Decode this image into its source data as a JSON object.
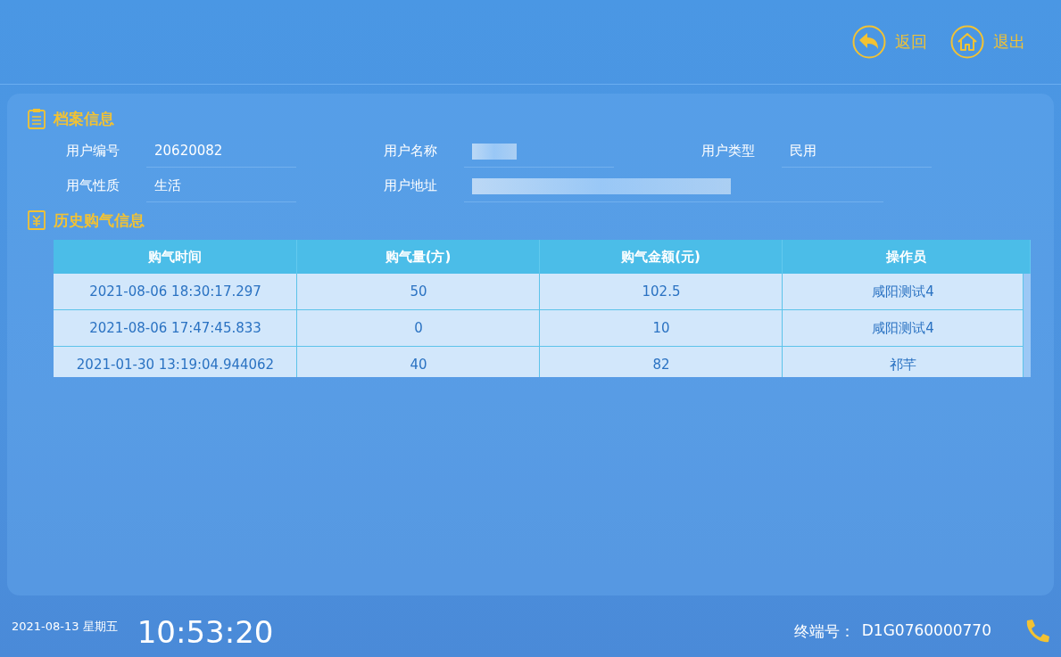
{
  "header": {
    "buttons": [
      {
        "kind": "back",
        "label": "返回"
      },
      {
        "kind": "home",
        "label": "退出"
      }
    ]
  },
  "profile": {
    "title": "档案信息",
    "fields": [
      {
        "label": "用户编号",
        "value": "20620082",
        "redacted": false
      },
      {
        "label": "用户名称",
        "redacted": true
      },
      {
        "label": "用户类型",
        "value": "民用",
        "redacted": false
      },
      {
        "label": "用气性质",
        "value": "生活",
        "redacted": false
      },
      {
        "label": "用户地址",
        "redacted": true,
        "wide": true
      }
    ]
  },
  "history": {
    "title": "历史购气信息",
    "columns": [
      "购气时间",
      "购气量(方)",
      "购气金额(元)",
      "操作员"
    ],
    "rows": [
      [
        "2021-08-06 18:30:17.297",
        "50",
        "102.5",
        "咸阳测试4"
      ],
      [
        "2021-08-06 17:47:45.833",
        "0",
        "10",
        "咸阳测试4"
      ],
      [
        "2021-01-30 13:19:04.944062",
        "40",
        "82",
        "祁芊"
      ]
    ]
  },
  "status_bar": {
    "date": "2021-08-13 星期五",
    "time": "10:53:20",
    "terminal_label": "终端号：",
    "terminal_id": "D1G0760000770"
  }
}
